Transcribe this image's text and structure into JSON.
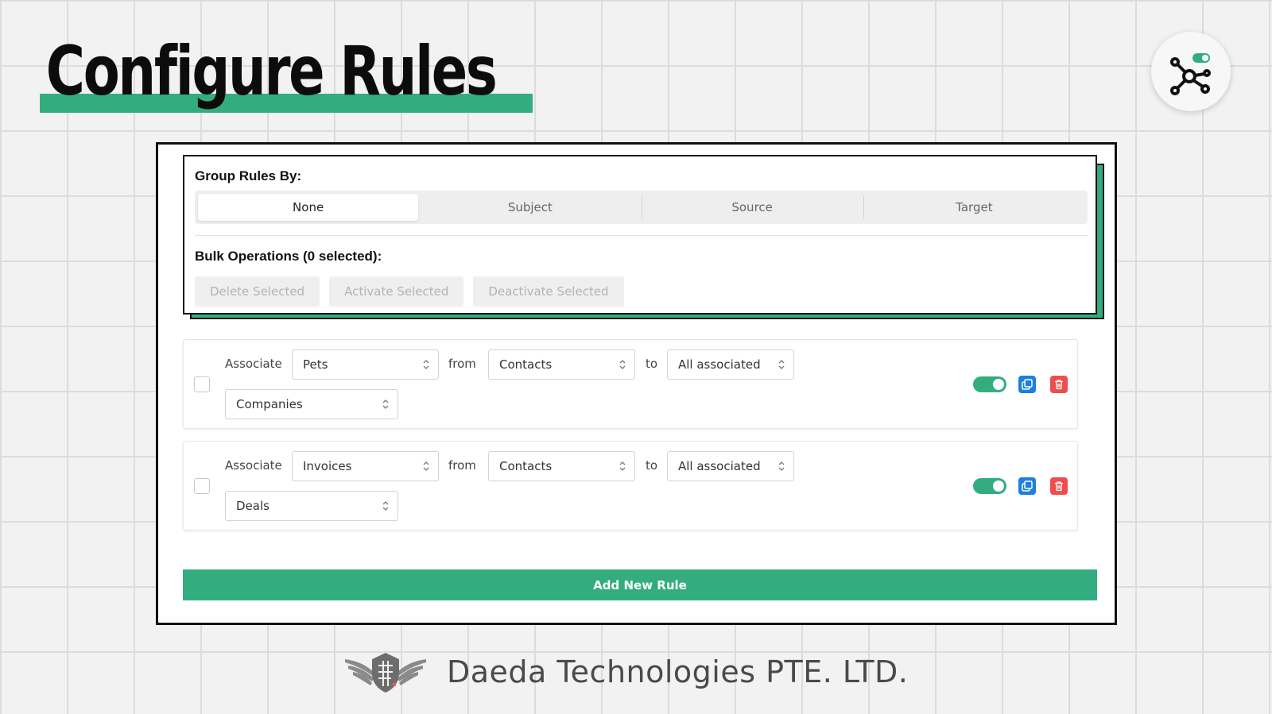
{
  "page": {
    "title": "Configure Rules",
    "accent_color": "#33ad7f"
  },
  "badge": {
    "icon": "network-toggle-icon"
  },
  "group_rules": {
    "label": "Group Rules By:",
    "options": [
      "None",
      "Subject",
      "Source",
      "Target"
    ],
    "selected": "None"
  },
  "bulk": {
    "label": "Bulk Operations (0 selected):",
    "delete_label": "Delete Selected",
    "activate_label": "Activate Selected",
    "deactivate_label": "Deactivate Selected"
  },
  "rules": [
    {
      "associate_label": "Associate",
      "object": "Pets",
      "from_label": "from",
      "source": "Contacts",
      "to_label": "to",
      "scope": "All associated",
      "target": "Companies",
      "active": true,
      "selected": false
    },
    {
      "associate_label": "Associate",
      "object": "Invoices",
      "from_label": "from",
      "source": "Contacts",
      "to_label": "to",
      "scope": "All associated",
      "target": "Deals",
      "active": true,
      "selected": false
    }
  ],
  "add_rule_label": "Add New Rule",
  "footer": {
    "company": "Daeda Technologies PTE. LTD.",
    "logo": "winged-shield-logo"
  }
}
